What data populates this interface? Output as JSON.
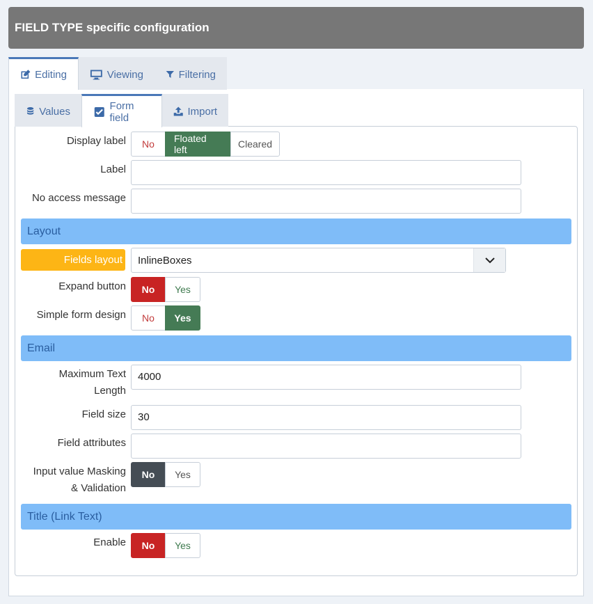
{
  "header": {
    "title": "FIELD TYPE specific configuration"
  },
  "outer_tabs": [
    {
      "label": "Editing",
      "icon": "edit-icon",
      "active": true
    },
    {
      "label": "Viewing",
      "icon": "monitor-icon",
      "active": false
    },
    {
      "label": "Filtering",
      "icon": "filter-icon",
      "active": false
    }
  ],
  "inner_tabs": [
    {
      "label": "Values",
      "icon": "database-icon",
      "active": false
    },
    {
      "label": "Form field",
      "icon": "checkbox-icon",
      "active": true
    },
    {
      "label": "Import",
      "icon": "upload-icon",
      "active": false
    }
  ],
  "form": {
    "display_label": {
      "label": "Display label",
      "options": [
        "No",
        "Floated left",
        "Cleared"
      ],
      "selected": "Floated left"
    },
    "label": {
      "label": "Label",
      "value": ""
    },
    "no_access_message": {
      "label": "No access message",
      "value": ""
    },
    "layout_section": "Layout",
    "fields_layout": {
      "label": "Fields layout",
      "value": "InlineBoxes"
    },
    "expand_button": {
      "label": "Expand button",
      "options": [
        "No",
        "Yes"
      ],
      "selected": "No"
    },
    "simple_form_design": {
      "label": "Simple form design",
      "options": [
        "No",
        "Yes"
      ],
      "selected": "Yes"
    },
    "email_section": "Email",
    "max_text_length": {
      "label_line1": "Maximum Text",
      "label_line2": "Length",
      "value": "4000"
    },
    "field_size": {
      "label": "Field size",
      "value": "30"
    },
    "field_attributes": {
      "label": "Field attributes",
      "value": ""
    },
    "input_masking": {
      "label_line1": "Input value Masking",
      "label_line2": "& Validation",
      "options": [
        "No",
        "Yes"
      ],
      "selected": "No"
    },
    "title_section": "Title (Link Text)",
    "enable": {
      "label": "Enable",
      "options": [
        "No",
        "Yes"
      ],
      "selected": "No"
    }
  }
}
